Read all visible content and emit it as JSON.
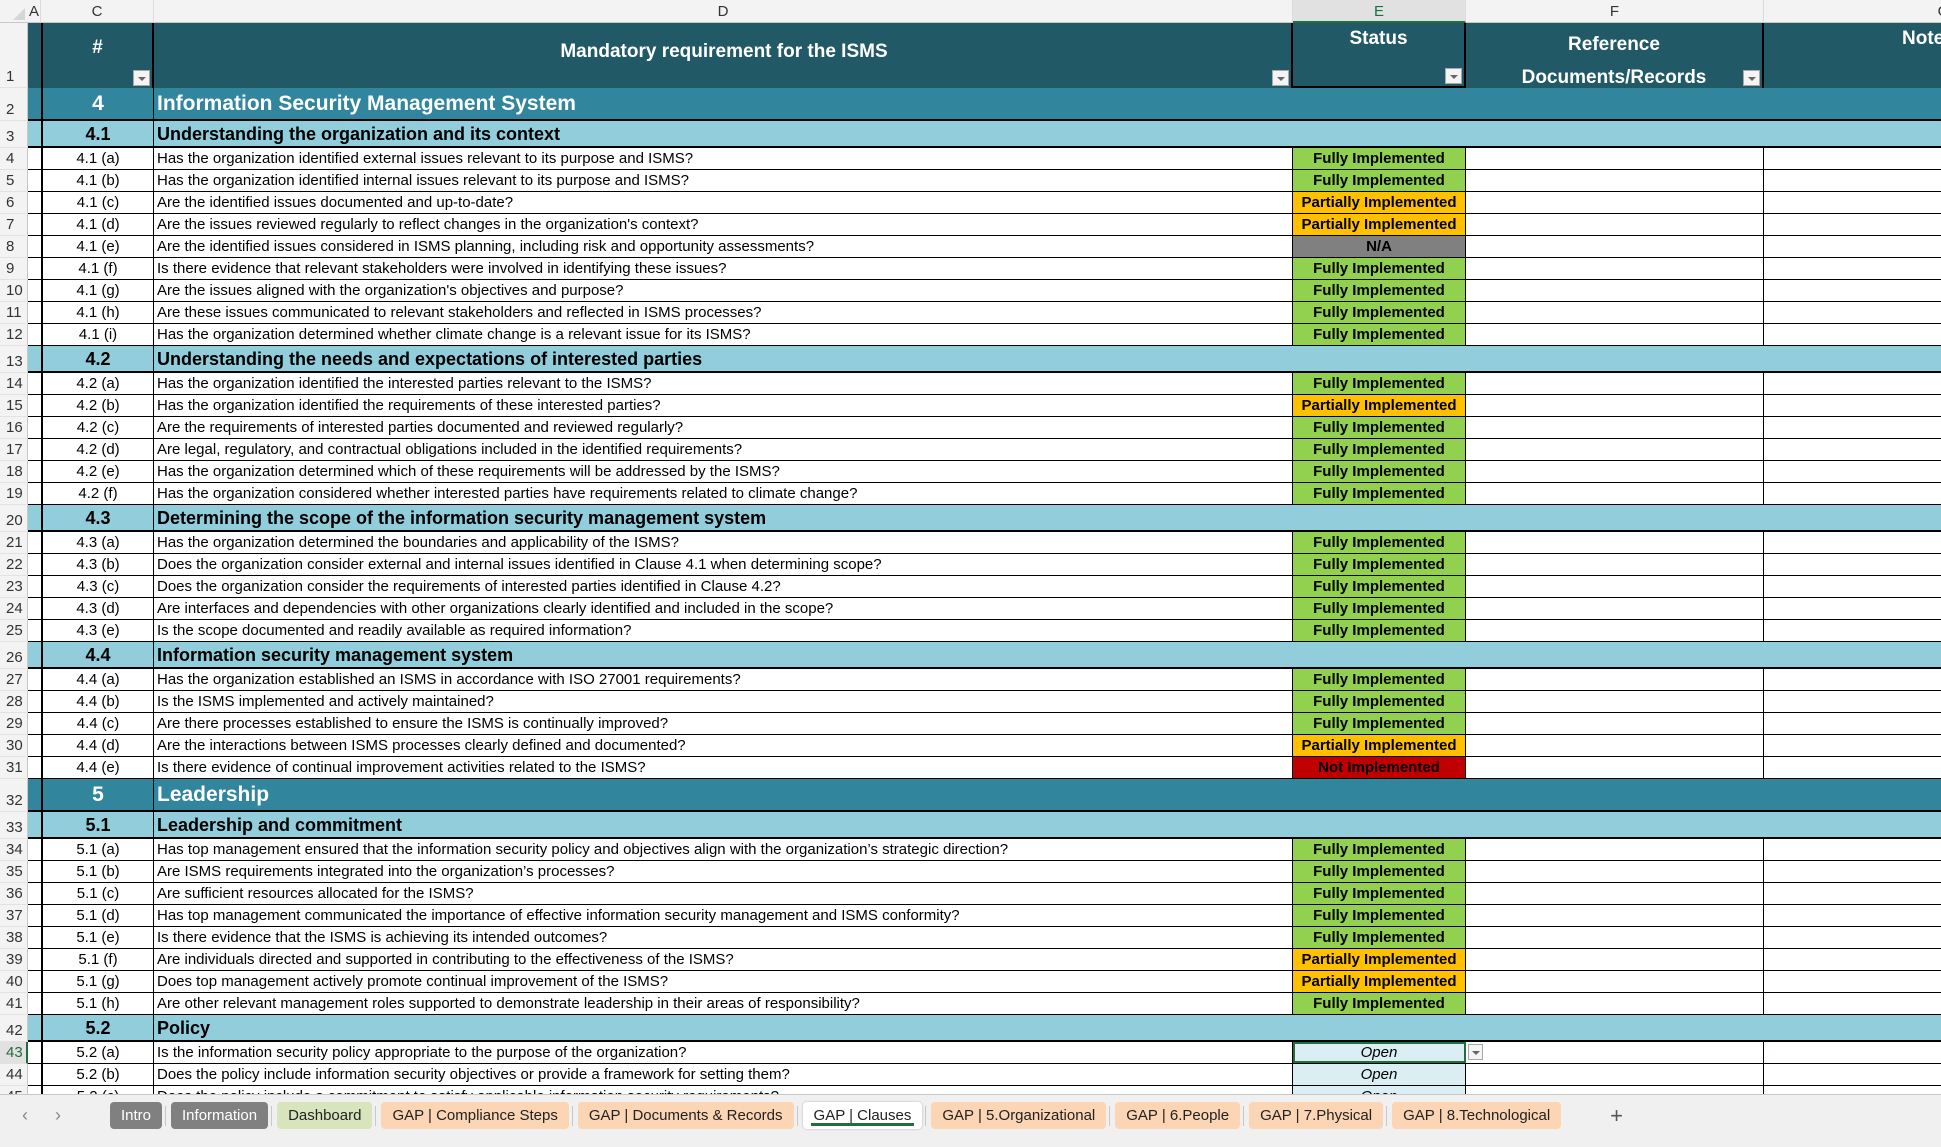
{
  "columns": [
    {
      "letter": "A"
    },
    {
      "letter": "C"
    },
    {
      "letter": "D"
    },
    {
      "letter": "E",
      "selected": true
    },
    {
      "letter": "F"
    },
    {
      "letter": "G"
    }
  ],
  "header": {
    "num": "#",
    "requirement": "Mandatory requirement for the ISMS",
    "status": "Status",
    "reference_line1": "Reference",
    "reference_line2": "Documents/Records",
    "notes": "Notes"
  },
  "status_colors": {
    "Fully Implemented": "#92d050",
    "Partially Implemented": "#ffc000",
    "N/A": "#808080",
    "Not Implemented": "#c00000",
    "Open": "#daeef3"
  },
  "rows": [
    {
      "n": "2",
      "type": "section",
      "num": "4",
      "text": "Information Security Management System"
    },
    {
      "n": "3",
      "type": "subsection",
      "num": "4.1",
      "text": "Understanding the organization and its context"
    },
    {
      "n": "4",
      "type": "item",
      "num": "4.1 (a)",
      "text": "Has the organization identified external issues relevant to its purpose and ISMS?",
      "status": "Fully Implemented"
    },
    {
      "n": "5",
      "type": "item",
      "num": "4.1 (b)",
      "text": "Has the organization identified internal issues relevant to its purpose and ISMS?",
      "status": "Fully Implemented"
    },
    {
      "n": "6",
      "type": "item",
      "num": "4.1 (c)",
      "text": "Are the identified issues documented and up-to-date?",
      "status": "Partially Implemented"
    },
    {
      "n": "7",
      "type": "item",
      "num": "4.1 (d)",
      "text": "Are the issues reviewed regularly to reflect changes in the organization's context?",
      "status": "Partially Implemented"
    },
    {
      "n": "8",
      "type": "item",
      "num": "4.1 (e)",
      "text": "Are the identified issues considered in ISMS planning, including risk and opportunity assessments?",
      "status": "N/A"
    },
    {
      "n": "9",
      "type": "item",
      "num": "4.1 (f)",
      "text": "Is there evidence that relevant stakeholders were involved in identifying these issues?",
      "status": "Fully Implemented"
    },
    {
      "n": "10",
      "type": "item",
      "num": "4.1 (g)",
      "text": "Are the issues aligned with the organization's objectives and purpose?",
      "status": "Fully Implemented"
    },
    {
      "n": "11",
      "type": "item",
      "num": "4.1 (h)",
      "text": "Are these issues communicated to relevant stakeholders and reflected in ISMS processes?",
      "status": "Fully Implemented"
    },
    {
      "n": "12",
      "type": "item",
      "num": "4.1 (i)",
      "text": "Has the organization determined whether climate change is a relevant issue for its ISMS?",
      "status": "Fully Implemented"
    },
    {
      "n": "13",
      "type": "subsection",
      "num": "4.2",
      "text": "Understanding the needs and expectations of interested parties"
    },
    {
      "n": "14",
      "type": "item",
      "num": "4.2 (a)",
      "text": "Has the organization identified the interested parties relevant to the ISMS?",
      "status": "Fully Implemented"
    },
    {
      "n": "15",
      "type": "item",
      "num": "4.2 (b)",
      "text": "Has the organization identified the requirements of these interested parties?",
      "status": "Partially Implemented"
    },
    {
      "n": "16",
      "type": "item",
      "num": "4.2 (c)",
      "text": "Are the requirements of interested parties documented and reviewed regularly?",
      "status": "Fully Implemented"
    },
    {
      "n": "17",
      "type": "item",
      "num": "4.2 (d)",
      "text": "Are legal, regulatory, and contractual obligations included in the identified requirements?",
      "status": "Fully Implemented"
    },
    {
      "n": "18",
      "type": "item",
      "num": "4.2 (e)",
      "text": "Has the organization determined which of these requirements will be addressed by the ISMS?",
      "status": "Fully Implemented"
    },
    {
      "n": "19",
      "type": "item",
      "num": "4.2 (f)",
      "text": "Has the organization considered whether interested parties have requirements related to climate change?",
      "status": "Fully Implemented"
    },
    {
      "n": "20",
      "type": "subsection",
      "num": "4.3",
      "text": "Determining the scope of the information security management system"
    },
    {
      "n": "21",
      "type": "item",
      "num": "4.3 (a)",
      "text": "Has the organization determined the boundaries and applicability of the ISMS?",
      "status": "Fully Implemented"
    },
    {
      "n": "22",
      "type": "item",
      "num": "4.3 (b)",
      "text": "Does the organization consider external and internal issues identified in Clause 4.1 when determining scope?",
      "status": "Fully Implemented"
    },
    {
      "n": "23",
      "type": "item",
      "num": "4.3 (c)",
      "text": "Does the organization consider the requirements of interested parties identified in Clause 4.2?",
      "status": "Fully Implemented"
    },
    {
      "n": "24",
      "type": "item",
      "num": "4.3 (d)",
      "text": "Are interfaces and dependencies with other organizations clearly identified and included in the scope?",
      "status": "Fully Implemented"
    },
    {
      "n": "25",
      "type": "item",
      "num": "4.3 (e)",
      "text": "Is the scope documented and readily available as required information?",
      "status": "Fully Implemented"
    },
    {
      "n": "26",
      "type": "subsection",
      "num": "4.4",
      "text": "Information security management system"
    },
    {
      "n": "27",
      "type": "item",
      "num": "4.4 (a)",
      "text": "Has the organization established an ISMS in accordance with ISO 27001 requirements?",
      "status": "Fully Implemented"
    },
    {
      "n": "28",
      "type": "item",
      "num": "4.4 (b)",
      "text": "Is the ISMS implemented and actively maintained?",
      "status": "Fully Implemented"
    },
    {
      "n": "29",
      "type": "item",
      "num": "4.4 (c)",
      "text": "Are there processes established to ensure the ISMS is continually improved?",
      "status": "Fully Implemented"
    },
    {
      "n": "30",
      "type": "item",
      "num": "4.4 (d)",
      "text": "Are the interactions between ISMS processes clearly defined and documented?",
      "status": "Partially Implemented"
    },
    {
      "n": "31",
      "type": "item",
      "num": "4.4 (e)",
      "text": "Is there evidence of continual improvement activities related to the ISMS?",
      "status": "Not Implemented"
    },
    {
      "n": "32",
      "type": "section",
      "num": "5",
      "text": "Leadership"
    },
    {
      "n": "33",
      "type": "subsection",
      "num": "5.1",
      "text": "Leadership and commitment"
    },
    {
      "n": "34",
      "type": "item",
      "num": "5.1 (a)",
      "text": "Has top management ensured that the information security policy and objectives align with the organization’s strategic direction?",
      "status": "Fully Implemented"
    },
    {
      "n": "35",
      "type": "item",
      "num": "5.1 (b)",
      "text": "Are ISMS requirements integrated into the organization’s processes?",
      "status": "Fully Implemented"
    },
    {
      "n": "36",
      "type": "item",
      "num": "5.1 (c)",
      "text": "Are sufficient resources allocated for the ISMS?",
      "status": "Fully Implemented"
    },
    {
      "n": "37",
      "type": "item",
      "num": "5.1 (d)",
      "text": "Has top management communicated the importance of effective information security management and ISMS conformity?",
      "status": "Fully Implemented"
    },
    {
      "n": "38",
      "type": "item",
      "num": "5.1 (e)",
      "text": "Is there evidence that the ISMS is achieving its intended outcomes?",
      "status": "Fully Implemented"
    },
    {
      "n": "39",
      "type": "item",
      "num": "5.1 (f)",
      "text": "Are individuals directed and supported in contributing to the effectiveness of the ISMS?",
      "status": "Partially Implemented"
    },
    {
      "n": "40",
      "type": "item",
      "num": "5.1 (g)",
      "text": "Does top management actively promote continual improvement of the ISMS?",
      "status": "Partially Implemented"
    },
    {
      "n": "41",
      "type": "item",
      "num": "5.1 (h)",
      "text": "Are other relevant management roles supported to demonstrate leadership in their areas of responsibility?",
      "status": "Fully Implemented"
    },
    {
      "n": "42",
      "type": "subsection",
      "num": "5.2",
      "text": "Policy"
    },
    {
      "n": "43",
      "type": "item",
      "num": "5.2 (a)",
      "text": "Is the information security policy appropriate to the purpose of the organization?",
      "status": "Open",
      "selected": true
    },
    {
      "n": "44",
      "type": "item",
      "num": "5.2 (b)",
      "text": "Does the policy include information security objectives or provide a framework for setting them?",
      "status": "Open"
    },
    {
      "n": "45",
      "type": "item",
      "num": "5.2 (c)",
      "text": "Does the policy include a commitment to satisfy applicable information security requirements?",
      "status": "Open"
    }
  ],
  "sheet_tabs": [
    {
      "label": "Intro",
      "style": "gray"
    },
    {
      "label": "Information",
      "style": "gray"
    },
    {
      "label": "Dashboard",
      "style": "green"
    },
    {
      "label": "GAP | Compliance Steps",
      "style": "orange"
    },
    {
      "label": "GAP | Documents & Records",
      "style": "orange"
    },
    {
      "label": "GAP | Clauses",
      "style": "active"
    },
    {
      "label": "GAP | 5.Organizational",
      "style": "orange"
    },
    {
      "label": "GAP | 6.People",
      "style": "orange"
    },
    {
      "label": "GAP | 7.Physical",
      "style": "orange"
    },
    {
      "label": "GAP | 8.Technological",
      "style": "orange"
    }
  ],
  "nav": {
    "prev": "‹",
    "next": "›",
    "add_sheet": "+"
  }
}
